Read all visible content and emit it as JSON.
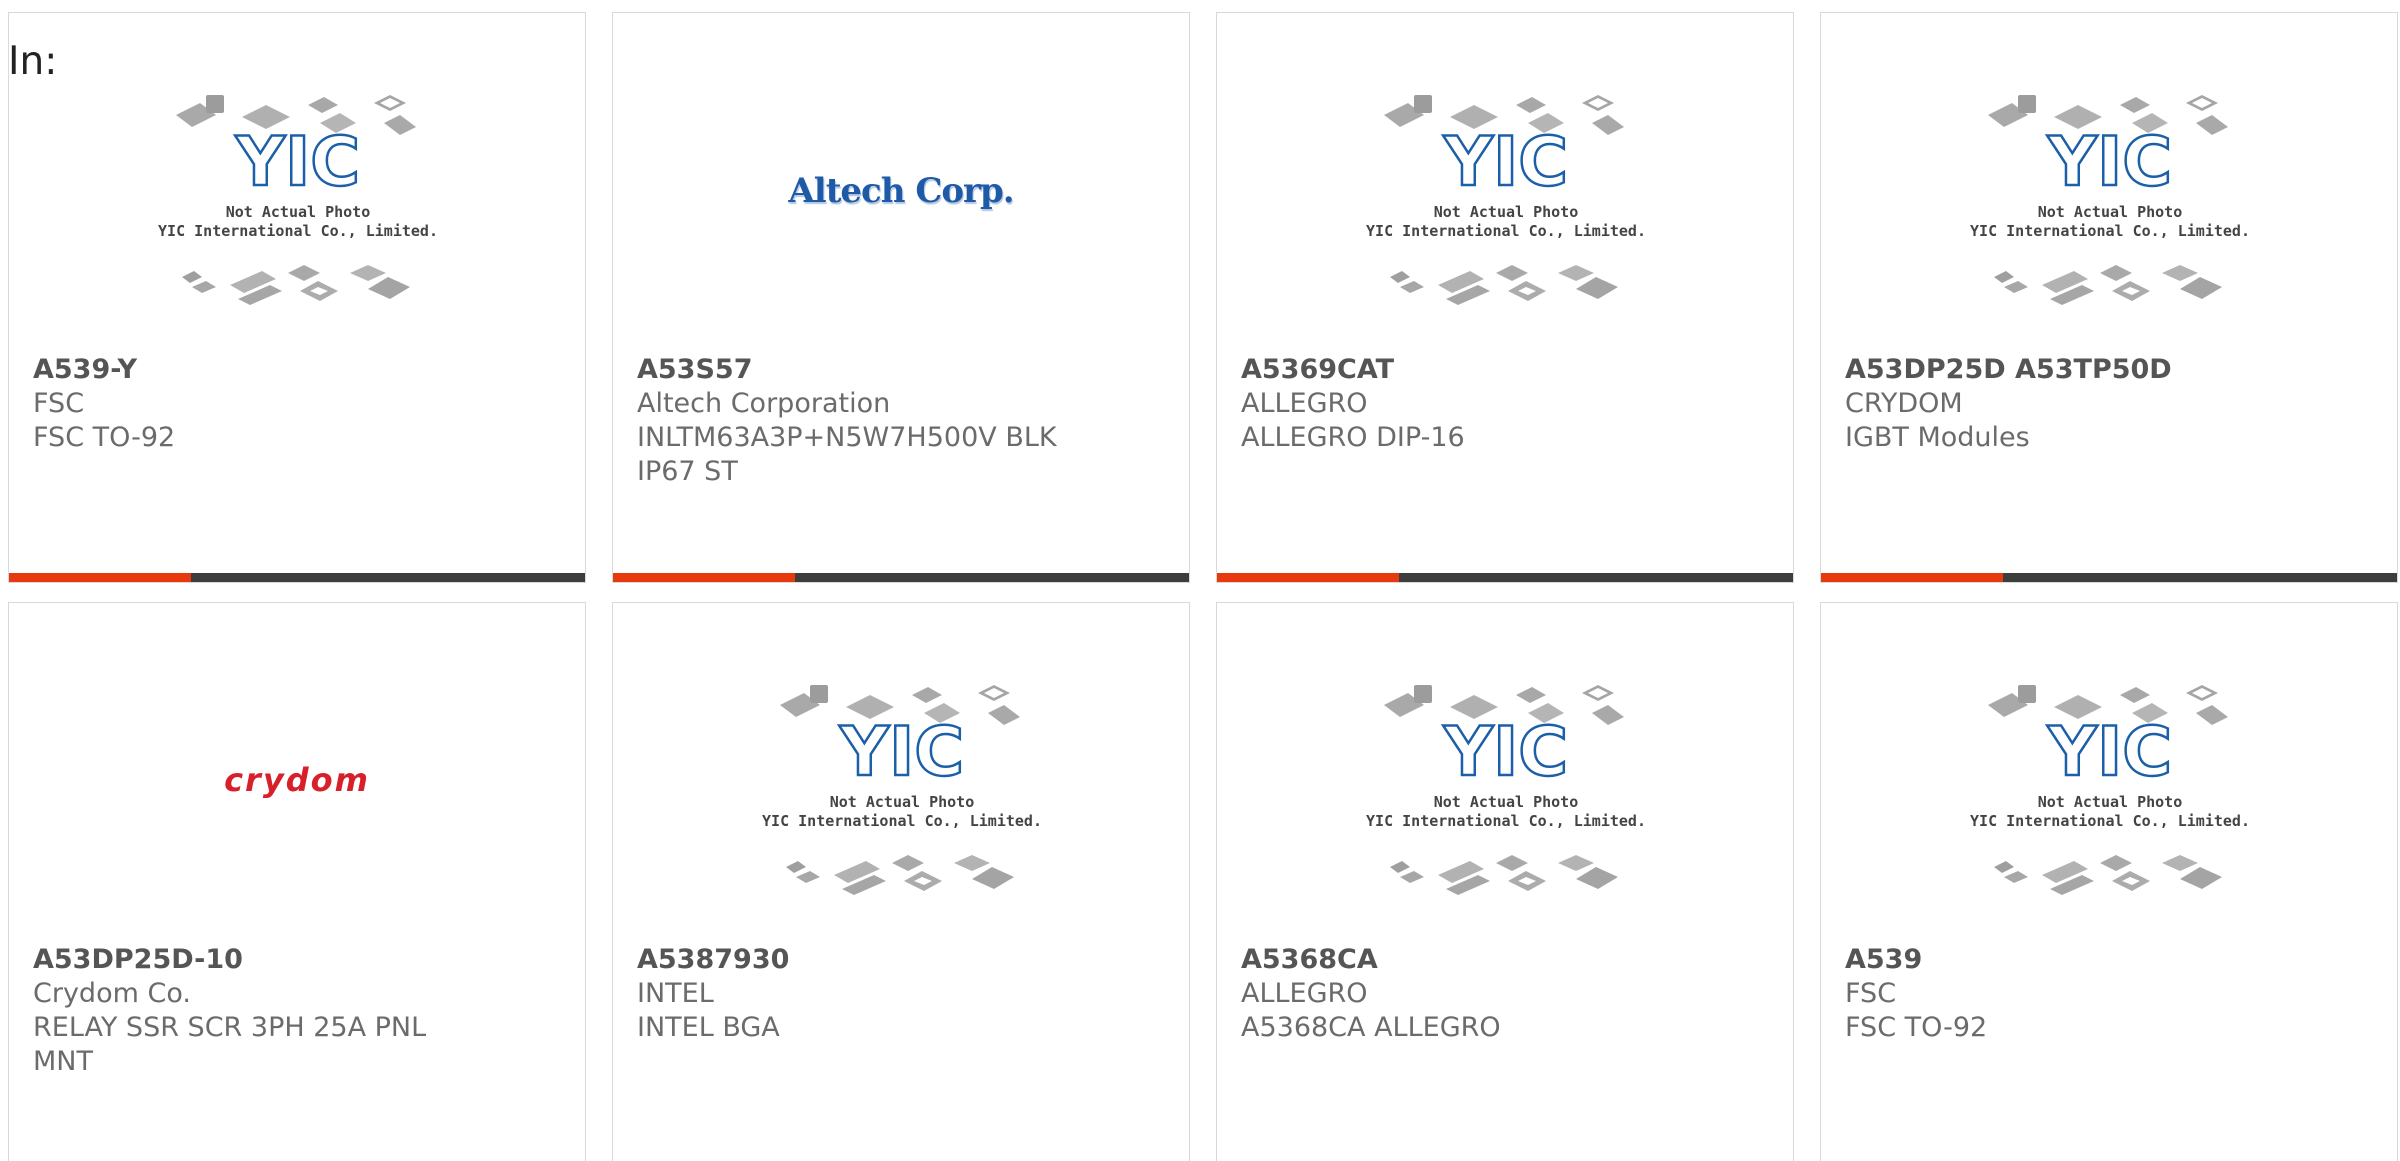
{
  "page": {
    "in_label": "In:"
  },
  "placeholder": {
    "logo": "YIC",
    "line1": "Not Actual Photo",
    "line2": "YIC International Co., Limited."
  },
  "brand_logos": {
    "altech": "Altech Corp.",
    "crydom": "crydom"
  },
  "colors": {
    "accent": "#e8380d",
    "bar": "#3d3d3d",
    "yic_blue": "#1a5fa8",
    "crydom_red": "#d8202a",
    "altech_blue": "#1f5aa6"
  },
  "products": [
    {
      "part": "A539-Y",
      "manufacturer": "FSC",
      "description": "FSC TO-92",
      "image": "placeholder"
    },
    {
      "part": "A53S57",
      "manufacturer": "Altech Corporation",
      "description": "INLTM63A3P+N5W7H500V BLK IP67 ST",
      "image": "altech"
    },
    {
      "part": "A5369CAT",
      "manufacturer": "ALLEGRO",
      "description": "ALLEGRO DIP-16",
      "image": "placeholder"
    },
    {
      "part": "A53DP25D A53TP50D",
      "manufacturer": "CRYDOM",
      "description": "IGBT Modules",
      "image": "placeholder"
    },
    {
      "part": "A53DP25D-10",
      "manufacturer": "Crydom Co.",
      "description": "RELAY SSR SCR 3PH 25A PNL MNT",
      "image": "crydom"
    },
    {
      "part": "A5387930",
      "manufacturer": "INTEL",
      "description": "INTEL BGA",
      "image": "placeholder"
    },
    {
      "part": "A5368CA",
      "manufacturer": "ALLEGRO",
      "description": "A5368CA ALLEGRO",
      "image": "placeholder"
    },
    {
      "part": "A539",
      "manufacturer": "FSC",
      "description": "FSC TO-92",
      "image": "placeholder"
    }
  ]
}
